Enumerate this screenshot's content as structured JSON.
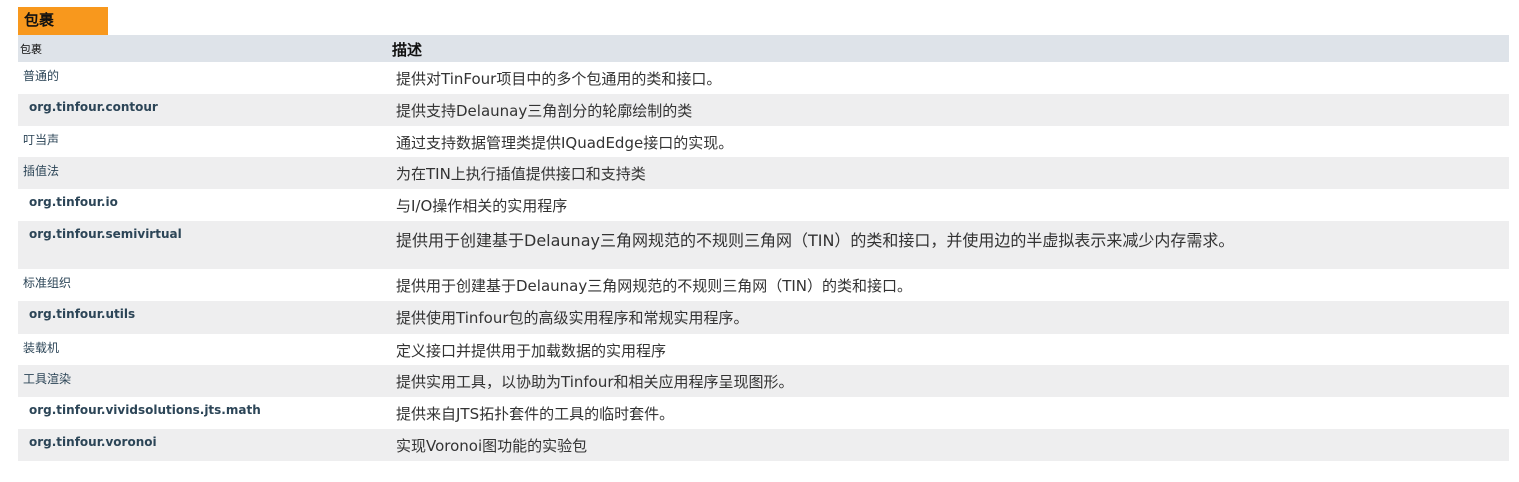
{
  "table": {
    "caption": "包裹",
    "header": {
      "col1": "包裹",
      "col2": "描述"
    },
    "rows": [
      {
        "name": "普通的",
        "desc": "提供对TinFour项目中的多个包通用的类和接口。"
      },
      {
        "name": "org.tinfour.contour",
        "desc": "提供支持Delaunay三角剖分的轮廓绘制的类"
      },
      {
        "name": "叮当声",
        "desc": "通过支持数据管理类提供IQuadEdge接口的实现。"
      },
      {
        "name": "插值法",
        "desc": "为在TIN上执行插值提供接口和支持类"
      },
      {
        "name": "org.tinfour.io",
        "desc": "与I/O操作相关的实用程序"
      },
      {
        "name": "org.tinfour.semivirtual",
        "desc": "提供用于创建基于Delaunay三角网规范的不规则三角网（TIN）的类和接口，并使用边的半虚拟表示来减少内存需求。"
      },
      {
        "name": "标准组织",
        "desc": "提供用于创建基于Delaunay三角网规范的不规则三角网（TIN）的类和接口。"
      },
      {
        "name": "org.tinfour.utils",
        "desc": "提供使用Tinfour包的高级实用程序和常规实用程序。"
      },
      {
        "name": "装载机",
        "desc": "定义接口并提供用于加载数据的实用程序"
      },
      {
        "name": "工具渲染",
        "desc": "提供实用工具，以协助为Tinfour和相关应用程序呈现图形。"
      },
      {
        "name": "org.tinfour.vividsolutions.jts.math",
        "desc": "提供来自JTS拓扑套件的工具的临时套件。"
      },
      {
        "name": "org.tinfour.voronoi",
        "desc": "实现Voronoi图功能的实验包"
      }
    ]
  }
}
